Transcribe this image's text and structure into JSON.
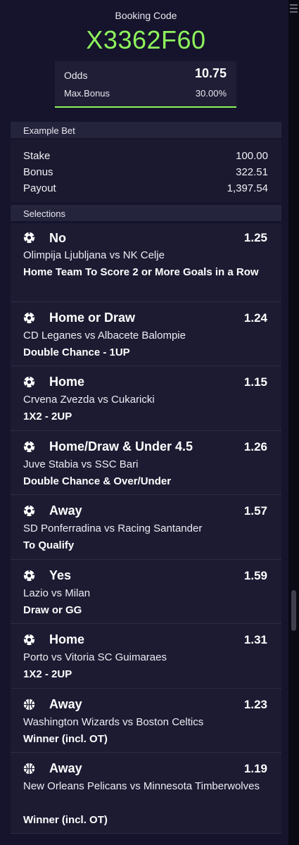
{
  "booking": {
    "label": "Booking Code",
    "code": "X3362F60",
    "odds_label": "Odds",
    "odds_value": "10.75",
    "bonus_label": "Max.Bonus",
    "bonus_value": "30.00%"
  },
  "example_bet": {
    "title": "Example Bet",
    "stake_label": "Stake",
    "stake_value": "100.00",
    "bonus_label": "Bonus",
    "bonus_value": "322.51",
    "payout_label": "Payout",
    "payout_value": "1,397.54"
  },
  "selections_title": "Selections",
  "selections": [
    {
      "sport": "soccer-ball-icon",
      "pick": "No",
      "odds": "1.25",
      "match": "Olimpija Ljubljana vs NK Celje",
      "market": "Home Team To Score 2 or More Goals in a Row"
    },
    {
      "sport": "soccer-ball-icon",
      "pick": "Home or Draw",
      "odds": "1.24",
      "match": "CD Leganes vs Albacete Balompie",
      "market": "Double Chance - 1UP"
    },
    {
      "sport": "soccer-ball-icon",
      "pick": "Home",
      "odds": "1.15",
      "match": "Crvena Zvezda vs Cukaricki",
      "market": "1X2 - 2UP"
    },
    {
      "sport": "soccer-ball-icon",
      "pick": "Home/Draw & Under 4.5",
      "odds": "1.26",
      "match": "Juve Stabia vs SSC Bari",
      "market": "Double Chance & Over/Under"
    },
    {
      "sport": "soccer-ball-icon",
      "pick": "Away",
      "odds": "1.57",
      "match": "SD Ponferradina vs Racing Santander",
      "market": "To Qualify"
    },
    {
      "sport": "soccer-ball-icon",
      "pick": "Yes",
      "odds": "1.59",
      "match": "Lazio vs Milan",
      "market": "Draw or GG"
    },
    {
      "sport": "soccer-ball-icon",
      "pick": "Home",
      "odds": "1.31",
      "match": "Porto vs Vitoria SC Guimaraes",
      "market": "1X2 - 2UP"
    },
    {
      "sport": "basketball-icon",
      "pick": "Away",
      "odds": "1.23",
      "match": "Washington Wizards vs Boston Celtics",
      "market": "Winner (incl. OT)"
    },
    {
      "sport": "basketball-icon",
      "pick": "Away",
      "odds": "1.19",
      "match": "New Orleans Pelicans vs Minnesota Timberwolves",
      "market": "Winner (incl. OT)"
    }
  ],
  "colors": {
    "accent": "#8ef35c",
    "background": "#15142c",
    "card": "#1c1b32"
  }
}
